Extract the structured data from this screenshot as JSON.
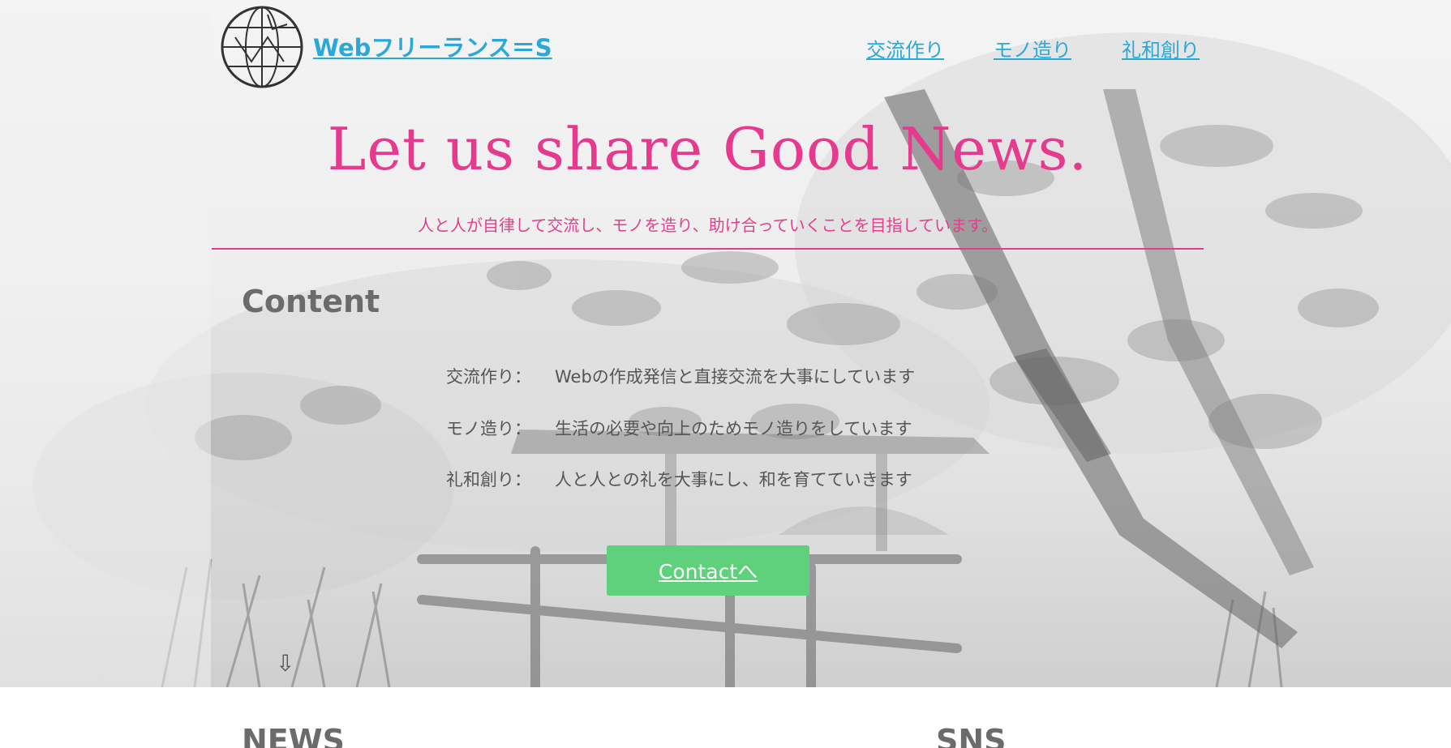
{
  "header": {
    "site_title": "Webフリーランス＝S",
    "logo_icon": "globe-icon",
    "nav": [
      {
        "label": "交流作り"
      },
      {
        "label": "モノ造り"
      },
      {
        "label": "礼和創り"
      }
    ]
  },
  "hero": {
    "headline": "Let us share Good News.",
    "tagline": "人と人が自律して交流し、モノを造り、助け合っていくことを目指しています。",
    "content_heading": "Content",
    "rows": [
      {
        "label": "交流作り：",
        "text": "Webの作成発信と直接交流を大事にしています"
      },
      {
        "label": "モノ造り：",
        "text": "生活の必要や向上のためモノ造りをしています"
      },
      {
        "label": "礼和創り：",
        "text": "人と人との礼を大事にし、和を育てていきます"
      }
    ],
    "contact_label": "Contactへ",
    "scroll_arrow": "⇩"
  },
  "sections": {
    "news_heading": "NEWS",
    "sns_heading": "SNS"
  },
  "colors": {
    "link": "#2aa9d8",
    "accent_pink": "#e63a8e",
    "button_green": "#5fd07b",
    "heading_gray": "#6b6b6b"
  }
}
